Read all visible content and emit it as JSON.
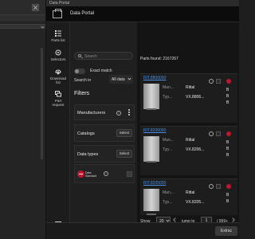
{
  "window": {
    "title": "Data Portal"
  },
  "header": {
    "portal_title": "Data Portal",
    "logo_icon": "box-icon"
  },
  "rail": [
    {
      "label": "Parts list",
      "icon": "list-icon"
    },
    {
      "label": "Selectors",
      "icon": "selector-icon"
    },
    {
      "label": "Download list",
      "icon": "download-icon"
    },
    {
      "label": "Part request",
      "icon": "chat-icon"
    }
  ],
  "filters": {
    "search_placeholder": "Search",
    "exact_match": "Exact match",
    "search_in_label": "Search in",
    "search_in_value": "All data",
    "heading": "Filters",
    "manufacturers": "Manufacturers",
    "catalogs": "Catalogs",
    "catalogs_button": "Select",
    "data_types": "Data types",
    "data_types_button": "Select",
    "data_standard_line1": "Data",
    "data_standard_line2": "Standard"
  },
  "results": {
    "found": "Parts found: 2167267",
    "field_manufacturer": "Man...",
    "field_type": "Typ...",
    "items": [
      {
        "link": "RIT.8806000",
        "manufacturer": "Rittal",
        "type": "VX.8806...",
        "right": [
          "B",
          "B",
          "B"
        ]
      },
      {
        "link": "RIT.8206000",
        "manufacturer": "Rittal",
        "type": "VX.8206...",
        "right": [
          "B",
          "B",
          "B"
        ]
      },
      {
        "link": "RIT.8205000",
        "manufacturer": "Rittal",
        "type": "VX.8205...",
        "right": [
          "B",
          "B"
        ]
      }
    ],
    "pager": {
      "show_label": "Show",
      "page_size": "20",
      "jump_label": "jump to",
      "page": "1",
      "total": "/ 999+"
    }
  },
  "footer": {
    "extract_label": "Extrac"
  },
  "colors": {
    "accent_link": "#4a90e2",
    "badge_red": "#c0152f"
  }
}
